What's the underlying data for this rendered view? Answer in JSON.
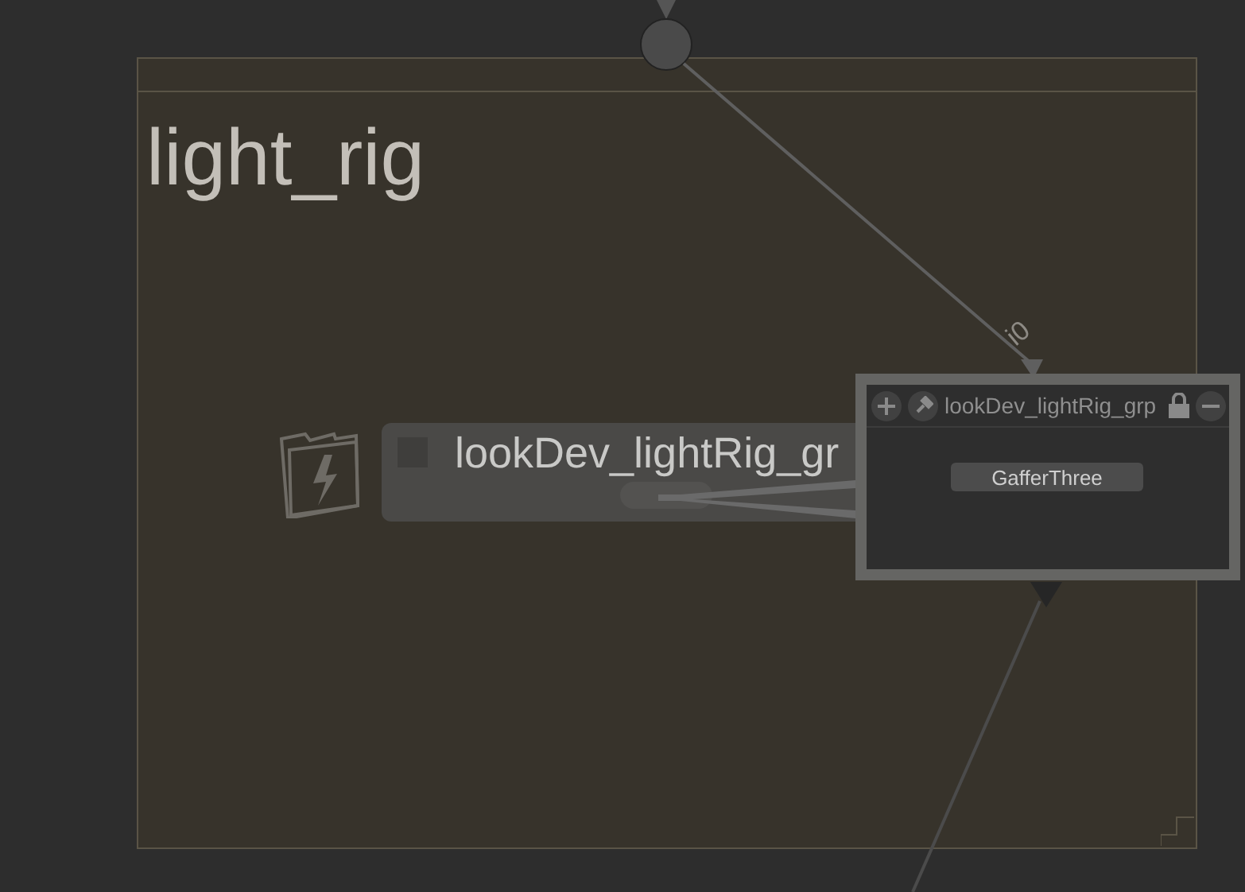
{
  "backdrop": {
    "title": "light_rig"
  },
  "group_node": {
    "label": "lookDev_lightRig_gr"
  },
  "input_port": {
    "label": "i0"
  },
  "panel": {
    "title": "lookDev_lightRig_grp",
    "locked": true,
    "child": {
      "label": "GafferThree"
    }
  }
}
